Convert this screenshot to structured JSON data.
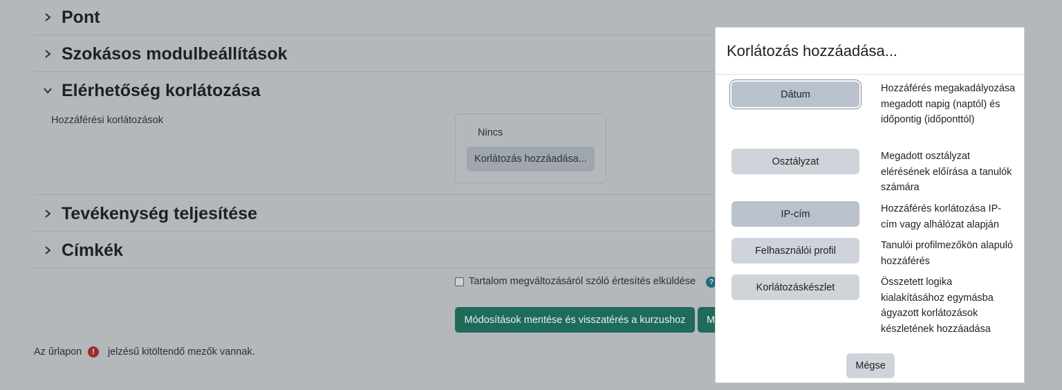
{
  "sections": {
    "pont": "Pont",
    "module_settings": "Szokásos modulbeállítások",
    "restrict_access": "Elérhetőség korlátozása",
    "completion": "Tevékenység teljesítése",
    "tags": "Címkék"
  },
  "restrictions": {
    "label": "Hozzáférési korlátozások",
    "none_text": "Nincs",
    "add_button": "Korlátozás hozzáadása..."
  },
  "notify_checkbox_label": "Tartalom megváltozásáról szóló értesítés elküldése",
  "buttons": {
    "save_return": "Módosítások mentése és visszatérés a kurzushoz",
    "save_display_partial": "M"
  },
  "required_note": {
    "before": "Az űrlapon",
    "after": "jelzésű kitöltendő mezők vannak."
  },
  "modal": {
    "title": "Korlátozás hozzáadása...",
    "options": [
      {
        "label": "Dátum",
        "description": "Hozzáférés megakadályozása megadott napig (naptól) és időpontig (időponttól)"
      },
      {
        "label": "Osztályzat",
        "description": "Megadott osztályzat elérésének előírása a tanulók számára"
      },
      {
        "label": "IP-cím",
        "description": "Hozzáférés korlátozása IP-cím vagy alhálózat alapján"
      },
      {
        "label": "Felhasználói profil",
        "description": "Tanulói profilmezőkön alapuló hozzáférés"
      },
      {
        "label": "Korlátozáskészlet",
        "description": "Összetett logika kialakításához egymásba ágyazott korlátozások készletének hozzáadása"
      }
    ],
    "cancel": "Mégse"
  },
  "icons": {
    "help": "?",
    "required": "!"
  }
}
